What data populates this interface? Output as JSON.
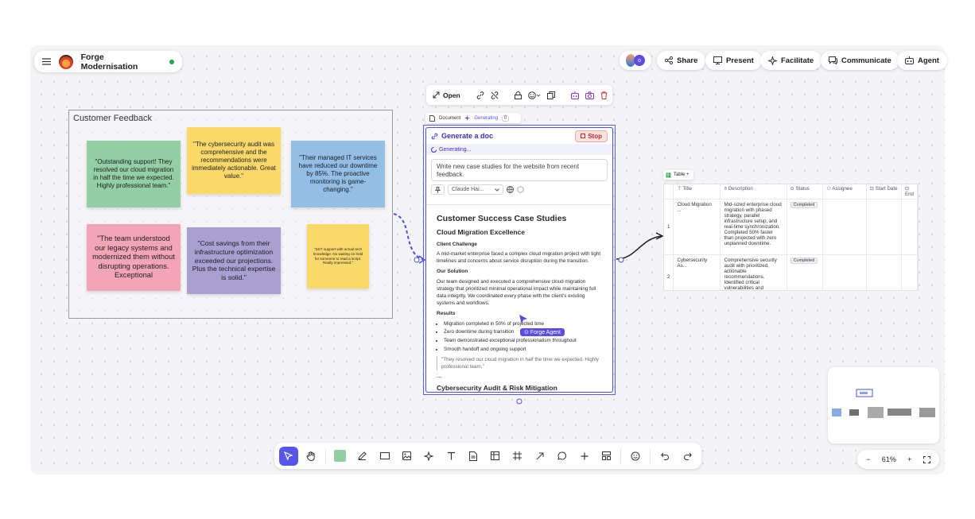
{
  "header": {
    "board_title": "Forge Modernisation",
    "actions": [
      {
        "label": "Share",
        "icon": "share-icon"
      },
      {
        "label": "Present",
        "icon": "present-icon"
      },
      {
        "label": "Facilitate",
        "icon": "sparkle-icon"
      },
      {
        "label": "Communicate",
        "icon": "chat-icon"
      },
      {
        "label": "Agent",
        "icon": "robot-icon"
      }
    ]
  },
  "frame": {
    "title": "Customer Feedback",
    "notes": [
      "\"Outstanding support! They resolved our cloud migration in half the time we expected. Highly professional team.\"",
      "\"The cybersecurity audit was comprehensive and the recommendations were immediately actionable. Great value.\"",
      "\"Their managed IT services have reduced our downtime by 85%. The proactive monitoring is game-changing.\"",
      "\"The team understood our legacy systems and modernized them without disrupting operations. Exceptional",
      "\"Cost savings from their infrastructure optimization exceeded our projections. Plus the technical expertise is solid.\"",
      "\"24/7 support with actual tech knowledge. No waiting on hold for someone to read a script. Really impressed.\""
    ]
  },
  "float_toolbar": {
    "open_label": "Open"
  },
  "doc_tab": {
    "label": "Document",
    "status": "Generating",
    "count": "0"
  },
  "doc": {
    "panel_title": "Generate a doc",
    "stop_label": "Stop",
    "generating": "Generating...",
    "prompt": "Write new case studies for the website from recent feedback",
    "model": "Claude Hai...",
    "h1": "Customer Success Case Studies",
    "section1_title": "Cloud Migration Excellence",
    "challenge_heading": "Client Challenge",
    "challenge_text": "A mid-market enterprise faced a complex cloud migration project with tight timelines and concerns about service disruption during the transition.",
    "solution_heading": "Our Solution",
    "solution_text": "Our team designed and executed a comprehensive cloud migration strategy that prioritized minimal operational impact while maintaining full data integrity. We coordinated every phase with the client's existing systems and workflows.",
    "results_heading": "Results",
    "results": [
      "Migration completed in 50% of projected time",
      "Zero downtime during transition",
      "Team demonstrated exceptional professionalism throughout",
      "Smooth handoff and ongoing support"
    ],
    "quote": "\"They resolved our cloud migration in half the time we expected. Highly professional team.\"",
    "divider": "---",
    "section2_title": "Cybersecurity Audit & Risk Mitigation",
    "agent_cursor_label": "Forge Agent"
  },
  "table": {
    "tab_label": "Table +",
    "columns": [
      "Title",
      "Description",
      "Status",
      "Assignee",
      "Start Date",
      "End"
    ],
    "rows": [
      {
        "num": "1",
        "title": "Cloud Migration ...",
        "description": "Mid-sized enterprise cloud migration with phased strategy, parallel infrastructure setup, and real-time synchronization. Completed 50% faster than projected with zero unplanned downtime.",
        "status": "Completed"
      },
      {
        "num": "2",
        "title": "Cybersecurity As...",
        "description": "Comprehensive security audit with prioritized, actionable recommendations. Identified critical vulnerabilities and provided",
        "status": "Completed"
      }
    ]
  },
  "zoom": {
    "level": "61%",
    "minus": "−",
    "plus": "+"
  },
  "colors": {
    "accent": "#5457e8",
    "note_green": "#93cfa4",
    "note_yellow": "#fbd86a",
    "note_blue": "#93bfe6",
    "note_pink": "#f3a5b8",
    "note_purple": "#a99fd0"
  }
}
